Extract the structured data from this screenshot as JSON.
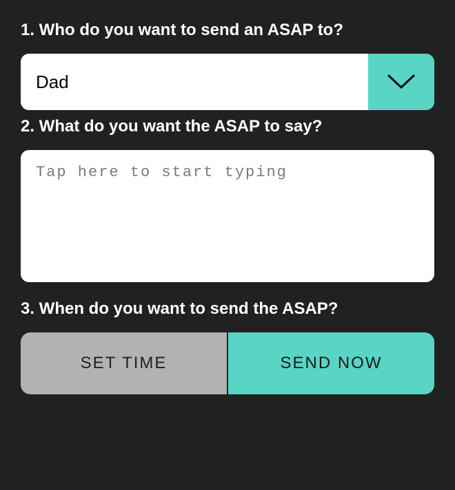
{
  "q1": {
    "label": "1. Who do you want to send an ASAP to?",
    "selected": "Dad"
  },
  "q2": {
    "label": "2. What do you want the ASAP to say?",
    "placeholder": "Tap here to start typing",
    "value": ""
  },
  "q3": {
    "label": "3. When do you want to send the ASAP?",
    "setTimeLabel": "SET TIME",
    "sendNowLabel": "SEND NOW"
  },
  "colors": {
    "accent": "#58d5c4",
    "background": "#212121",
    "secondaryButton": "#b2b2b2"
  }
}
